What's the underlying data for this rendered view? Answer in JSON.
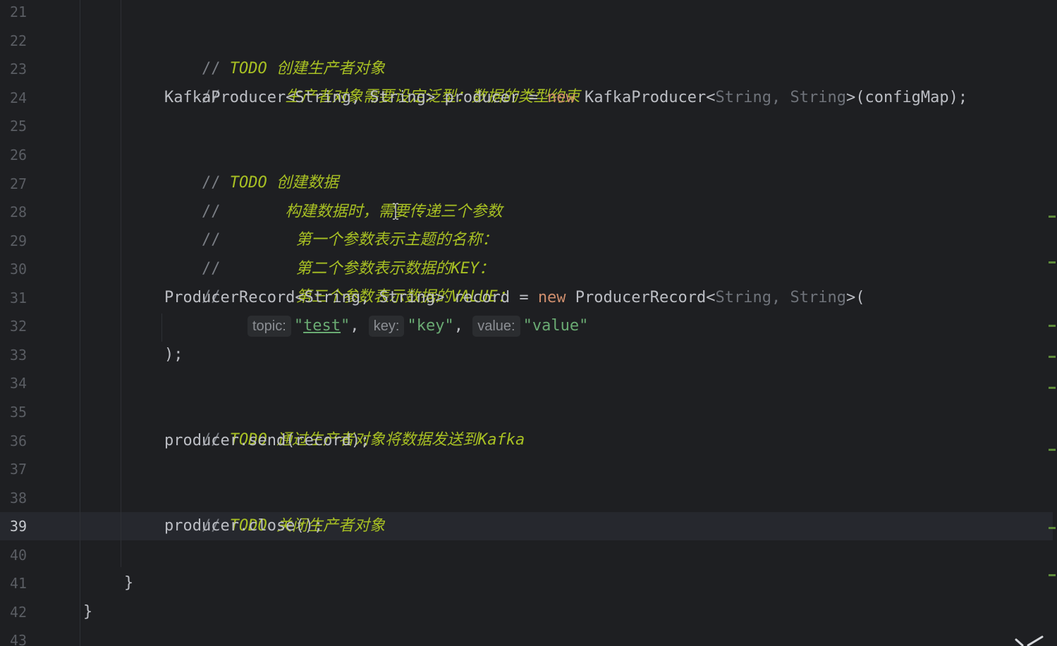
{
  "gutter": {
    "line_numbers": [
      "21",
      "22",
      "23",
      "24",
      "25",
      "26",
      "27",
      "28",
      "29",
      "30",
      "31",
      "32",
      "33",
      "34",
      "35",
      "36",
      "37",
      "38",
      "39",
      "40",
      "41",
      "42",
      "43"
    ],
    "current_line": "39"
  },
  "code": {
    "l22": {
      "slash": "//",
      "todo": "TODO",
      "text": "创建生产者对象"
    },
    "l23": {
      "slash": "//",
      "text": "生产者对象需要设定泛型：数据的类型约束"
    },
    "l24": {
      "a": "KafkaProducer<String, String> producer = ",
      "kw": "new",
      "b": " KafkaProducer<",
      "g1": "String",
      "g2": ", ",
      "g3": "String",
      "c": ">(configMap);"
    },
    "l26": {
      "slash": "//",
      "todo": "TODO",
      "text": "创建数据"
    },
    "l27": {
      "slash": "//",
      "text": "构建数据时，需要传递三个参数"
    },
    "l28": {
      "slash": "//",
      "text": "第一个参数表示主题的名称："
    },
    "l29": {
      "slash": "//",
      "text": "第二个参数表示数据的KEY："
    },
    "l30": {
      "slash": "//",
      "text": "第三个参数表示数据的VALUE："
    },
    "l31": {
      "a": "ProducerRecord<String, String> record = ",
      "kw": "new",
      "b": " ProducerRecord<",
      "g1": "String",
      "g2": ", ",
      "g3": "String",
      "c": ">("
    },
    "l32": {
      "hint_topic": "topic:",
      "q1": "\"",
      "topic_val": "test",
      "q2": "\"",
      "sep1": ", ",
      "hint_key": "key:",
      "key_val": "\"key\"",
      "sep2": ", ",
      "hint_value": "value:",
      "value_val": "\"value\""
    },
    "l33": {
      "text": ");"
    },
    "l35": {
      "slash": "//",
      "todo": "TODO",
      "text": "通过生产者对象将数据发送到Kafka"
    },
    "l36": {
      "text": "producer.send(record);"
    },
    "l38": {
      "slash": "//",
      "todo": "TODO",
      "text": "关闭生产者对象"
    },
    "l39": {
      "text": "producer.close();"
    },
    "l41": {
      "text": "}"
    },
    "l42": {
      "text": "}"
    }
  },
  "colors": {
    "background": "#1e1f22",
    "comment": "#7a7e85",
    "todo": "#a8c023",
    "keyword": "#cf8e6d",
    "string": "#6aab73",
    "generic": "#6f737a",
    "text": "#bcbec4",
    "change_marker": "#5e8a3a"
  },
  "icons": {
    "caret": "ibeam-cursor-icon",
    "corner": "expand-corner-icon"
  }
}
